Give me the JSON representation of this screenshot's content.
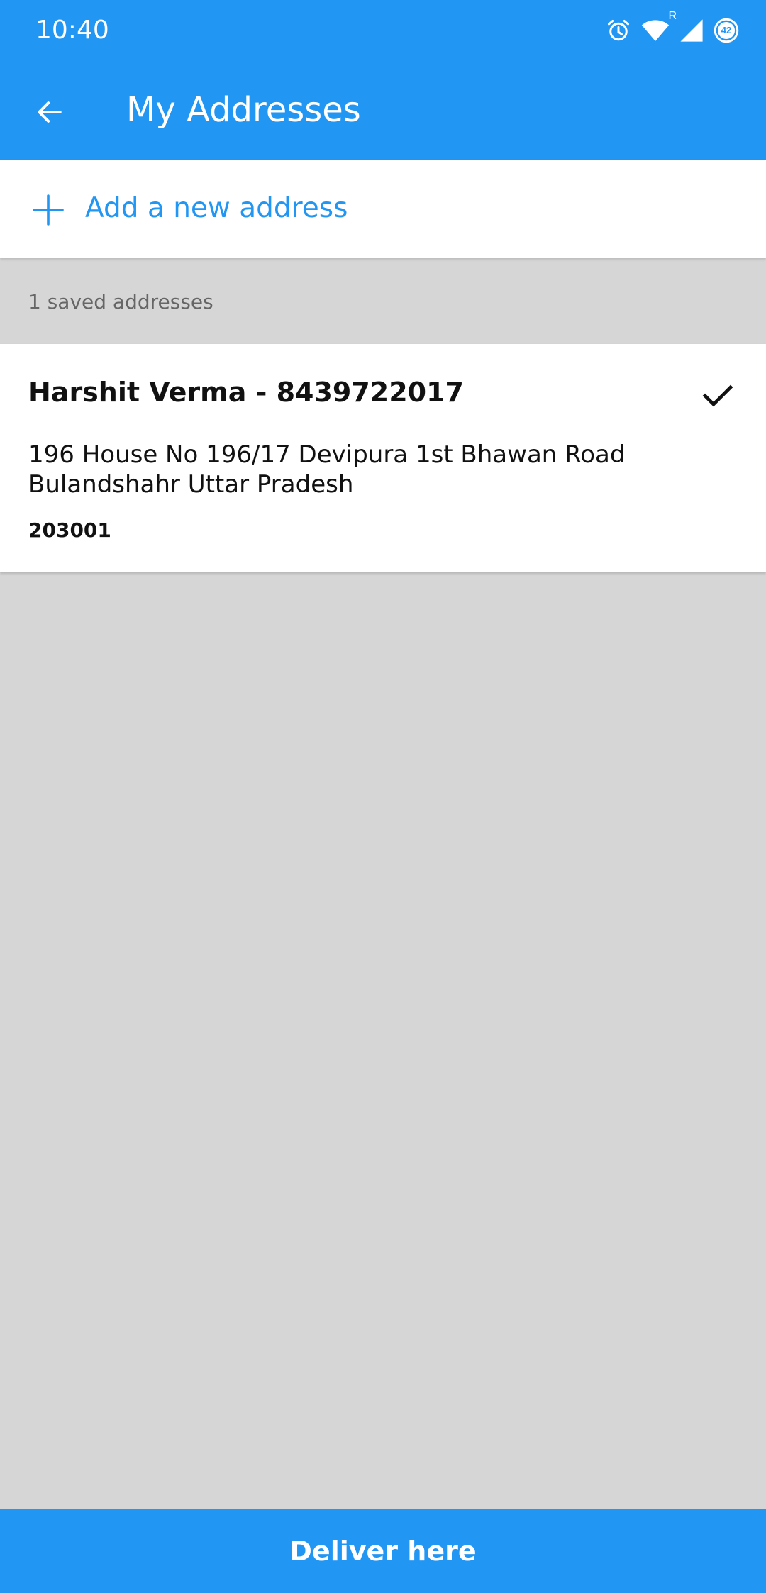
{
  "status_bar": {
    "time": "10:40",
    "network_type": "R",
    "battery_level": "42",
    "icons": [
      "alarm-icon",
      "wifi-icon",
      "signal-icon",
      "battery-icon"
    ]
  },
  "app_bar": {
    "back_icon": "arrow-left-icon",
    "title": "My Addresses"
  },
  "add_address": {
    "icon": "plus-icon",
    "label": "Add a new address"
  },
  "saved_addresses": {
    "count_label": "1 saved addresses",
    "items": [
      {
        "name_phone": "Harshit Verma - 8439722017",
        "address": "196 House No 196/17 Devipura 1st Bhawan Road Bulandshahr Uttar Pradesh",
        "pincode": "203001",
        "selected": true,
        "selected_icon": "check-icon"
      }
    ]
  },
  "footer": {
    "deliver_label": "Deliver here"
  },
  "colors": {
    "primary": "#2196f3",
    "background": "#d6d6d7",
    "card": "#ffffff",
    "muted_text": "#666666"
  }
}
